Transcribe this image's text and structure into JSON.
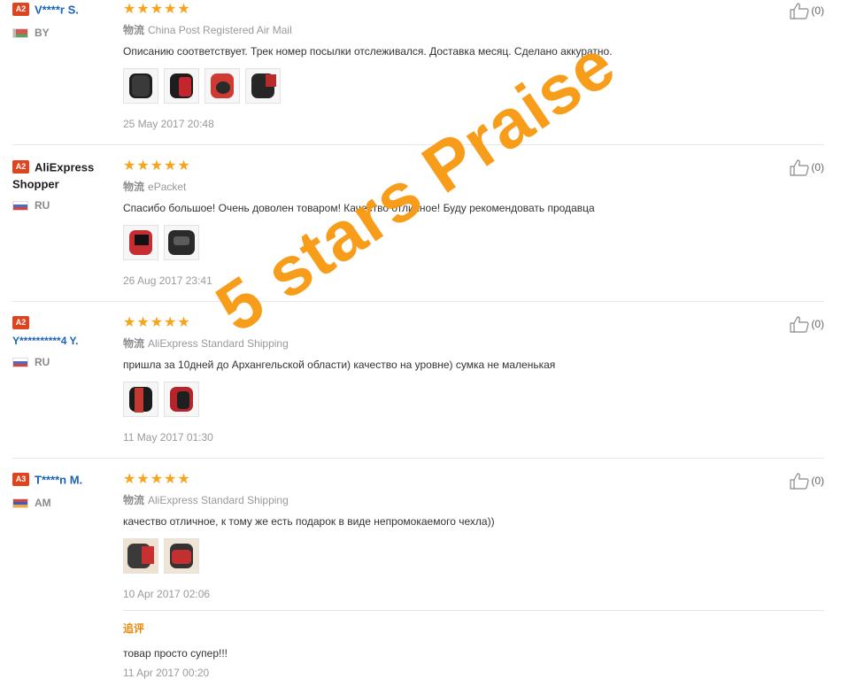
{
  "reviews": [
    {
      "level": "A2",
      "name": "V****r S.",
      "name_style": "blue",
      "country": "BY",
      "rating": 5,
      "shipping_label": "物流",
      "shipping": "China Post Registered Air Mail",
      "text": "Описанию соответствует. Трек номер посылки отслеживался. Доставка месяц. Сделано аккуратно.",
      "photos": 4,
      "date": "25 May 2017 20:48",
      "helpful": "(0)"
    },
    {
      "level": "A2",
      "name": "AliExpress Shopper",
      "name_style": "dark",
      "country": "RU",
      "rating": 5,
      "shipping_label": "物流",
      "shipping": "ePacket",
      "text": "Спасибо большое! Очень доволен товаром! Качество отличное! Буду рекомендовать продавца",
      "photos": 2,
      "date": "26 Aug 2017 23:41",
      "helpful": "(0)"
    },
    {
      "level": "A2",
      "name": "Y**********4 Y.",
      "name_style": "blue",
      "country": "RU",
      "rating": 5,
      "shipping_label": "物流",
      "shipping": "AliExpress Standard Shipping",
      "text": "пришла за 10дней до Архангельской области) качество на уровне) сумка не маленькая",
      "photos": 2,
      "date": "11 May 2017 01:30",
      "helpful": "(0)"
    },
    {
      "level": "A3",
      "name": "T****n M.",
      "name_style": "blue",
      "country": "AM",
      "rating": 5,
      "shipping_label": "物流",
      "shipping": "AliExpress Standard Shipping",
      "text": "качество отличное, к тому же есть подарок в виде непромокаемого чехла))",
      "photos": 2,
      "date": "10 Apr 2017 02:06",
      "helpful": "(0)",
      "followup": {
        "label": "追评",
        "text": "товар просто супер!!!",
        "date": "11 Apr 2017 00:20"
      }
    }
  ],
  "watermark": "5 stars Praise",
  "colors": {
    "star": "#f7a41c",
    "level_badge": "#e0441f",
    "buyer_name": "#1a63b8",
    "watermark": "#f79a12",
    "followup_label": "#e98a0c"
  }
}
